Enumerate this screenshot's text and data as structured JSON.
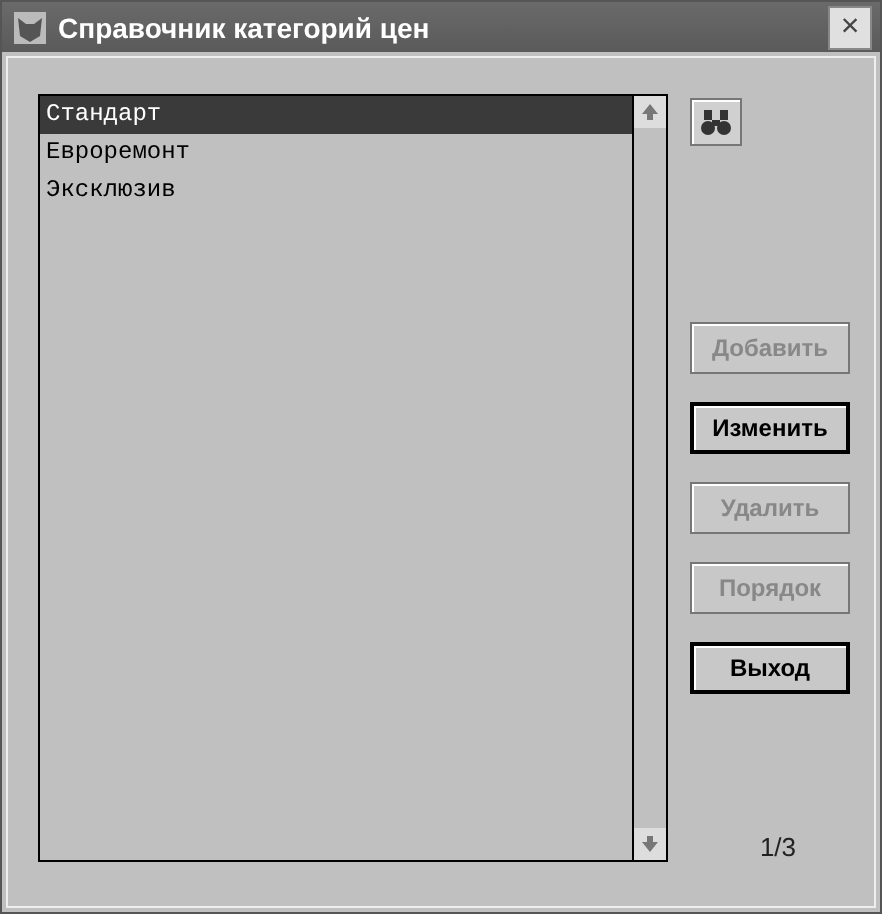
{
  "window": {
    "title": "Справочник категорий цен",
    "close": "×"
  },
  "list": {
    "items": [
      {
        "label": "Стандарт",
        "selected": true
      },
      {
        "label": "Евроремонт",
        "selected": false
      },
      {
        "label": "Эксклюзив",
        "selected": false
      }
    ]
  },
  "buttons": [
    {
      "label": "Добавить",
      "disabled": true
    },
    {
      "label": "Изменить",
      "disabled": false
    },
    {
      "label": "Удалить",
      "disabled": true
    },
    {
      "label": "Порядок",
      "disabled": true
    },
    {
      "label": "Выход",
      "disabled": false
    }
  ],
  "counter": "1/3"
}
